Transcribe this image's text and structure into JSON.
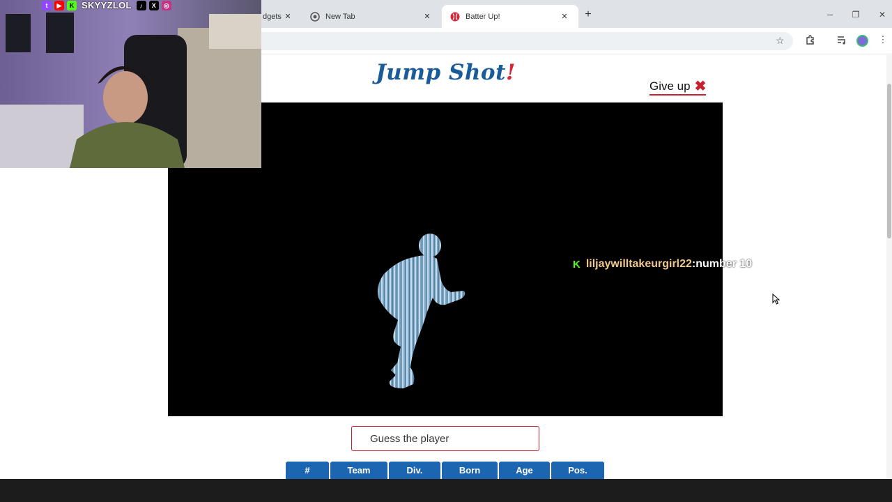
{
  "browser": {
    "tabs": [
      {
        "label": "dgets",
        "active": false
      },
      {
        "label": "New Tab",
        "active": false
      },
      {
        "label": "Batter Up!",
        "active": true
      }
    ]
  },
  "page": {
    "title_main": "Jump Shot",
    "title_bang": "!",
    "give_up_label": "Give up",
    "guess_placeholder": "Guess the player",
    "columns": [
      "#",
      "Team",
      "Div.",
      "Born",
      "Age",
      "Pos."
    ]
  },
  "stream": {
    "handle": "SKYYZLOL",
    "chat_user": "liljaywilltakeurgirl22",
    "chat_sep": " : ",
    "chat_message": "number 10"
  },
  "colors": {
    "accent_blue": "#1c65b0",
    "accent_red": "#c71f2e",
    "kick_green": "#53fc18"
  }
}
